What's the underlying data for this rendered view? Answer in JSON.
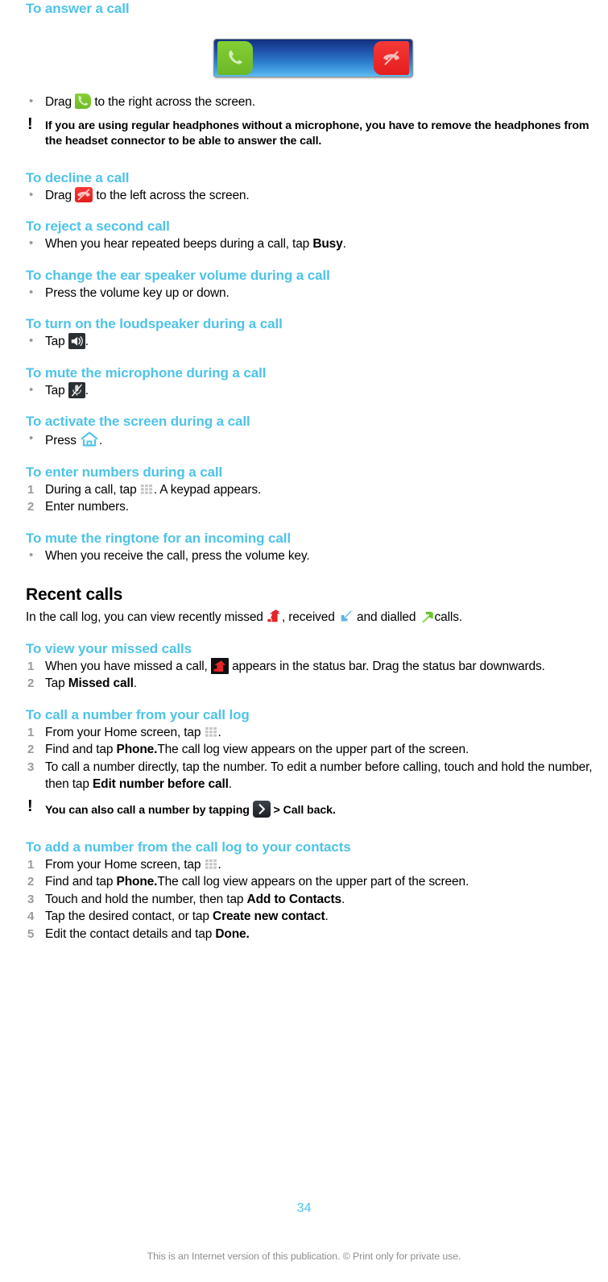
{
  "document": {
    "page_number": "34",
    "copyright": "This is an Internet version of this publication. © Print only for private use."
  },
  "sections": {
    "answer_call": {
      "heading": "To answer a call",
      "bullet": {
        "before": "Drag",
        "after": "to the right across the screen."
      },
      "note": "If you are using regular headphones without a microphone, you have to remove the headphones from the headset connector to be able to answer the call."
    },
    "decline_call": {
      "heading": "To decline a call",
      "bullet": {
        "before": "Drag",
        "after": "to the left across the screen."
      }
    },
    "reject_second": {
      "heading": "To reject a second call",
      "bullet_a": "When you hear repeated beeps during a call, tap ",
      "bullet_b": "Busy",
      "bullet_c": "."
    },
    "ear_speaker_volume": {
      "heading": "To change the ear speaker volume during a call",
      "bullet": "Press the volume key up or down."
    },
    "loudspeaker": {
      "heading": "To turn on the loudspeaker during a call",
      "bullet_before": "Tap",
      "bullet_after": "."
    },
    "mute_mic": {
      "heading": "To mute the microphone during a call",
      "bullet_before": "Tap",
      "bullet_after": "."
    },
    "activate_screen": {
      "heading": "To activate the screen during a call",
      "bullet_before": "Press",
      "bullet_after": "."
    },
    "enter_numbers": {
      "heading": "To enter numbers during a call",
      "steps": [
        {
          "num": "1",
          "before": "During a call, tap",
          "after": ". A keypad appears."
        },
        {
          "num": "2",
          "before": "Enter numbers.",
          "after": ""
        }
      ]
    },
    "mute_ringtone": {
      "heading": "To mute the ringtone for an incoming call",
      "bullet": "When you receive the call, press the volume key."
    },
    "recent_calls": {
      "heading": "Recent calls",
      "intro_a": "In the call log, you can view recently missed",
      "intro_b": ", received",
      "intro_c": "and dialled",
      "intro_d": "calls."
    },
    "view_missed": {
      "heading": "To view your missed calls",
      "step1_a": "When you have missed a call,",
      "step1_b": "appears in the status bar. Drag the status bar downwards.",
      "step2_a": "Tap ",
      "step2_b": "Missed call",
      "step2_c": ".",
      "num1": "1",
      "num2": "2"
    },
    "call_from_log": {
      "heading": "To call a number from your call log",
      "step1_num": "1",
      "step1_before": "From your Home screen, tap",
      "step1_after": ".",
      "step2_num": "2",
      "step2_a": "Find and tap ",
      "step2_b": "Phone.",
      "step2_c": "The call log view appears on the upper part of the screen.",
      "step3_num": "3",
      "step3_a": "To call a number directly, tap the number. To edit a number before calling, touch and hold the number, then tap ",
      "step3_b": "Edit number before call",
      "step3_c": ".",
      "note_a": "You can also call a number by tapping",
      "note_b": "> Call back."
    },
    "add_to_contacts": {
      "heading": "To add a number from the call log to your contacts",
      "step1_num": "1",
      "step1_before": "From your Home screen, tap",
      "step1_after": ".",
      "step2_num": "2",
      "step2_a": "Find and tap ",
      "step2_b": "Phone.",
      "step2_c": "The call log view appears on the upper part of the screen.",
      "step3_num": "3",
      "step3_a": "Touch and hold the number, then tap ",
      "step3_b": "Add to Contacts",
      "step3_c": ".",
      "step4_num": "4",
      "step4_a": "Tap the desired contact, or tap ",
      "step4_b": "Create new contact",
      "step4_c": ".",
      "step5_num": "5",
      "step5_a": "Edit the contact details and tap ",
      "step5_b": "Done.",
      "step5_c": ""
    }
  },
  "icons": {
    "answer_call": "green-answer-call-icon",
    "decline_call": "red-decline-call-icon",
    "loudspeaker": "loudspeaker-icon",
    "mute_microphone": "mute-microphone-icon",
    "home": "home-icon",
    "keypad": "keypad-grid-icon",
    "missed_call": "missed-call-arrow-icon",
    "received_call": "received-call-arrow-icon",
    "dialled_call": "dialled-call-arrow-icon",
    "missed_call_status": "missed-call-status-bar-icon",
    "chevron_right": "chevron-right-icon"
  },
  "colors": {
    "heading_cyan": "#4ec3e8",
    "answer_green": "#72c02c",
    "decline_red": "#ee2b2b",
    "received_blue": "#4aa8dd",
    "dialled_green": "#5cb52a",
    "missed_red": "#e62229",
    "muted_grey": "#9a9a9a"
  }
}
